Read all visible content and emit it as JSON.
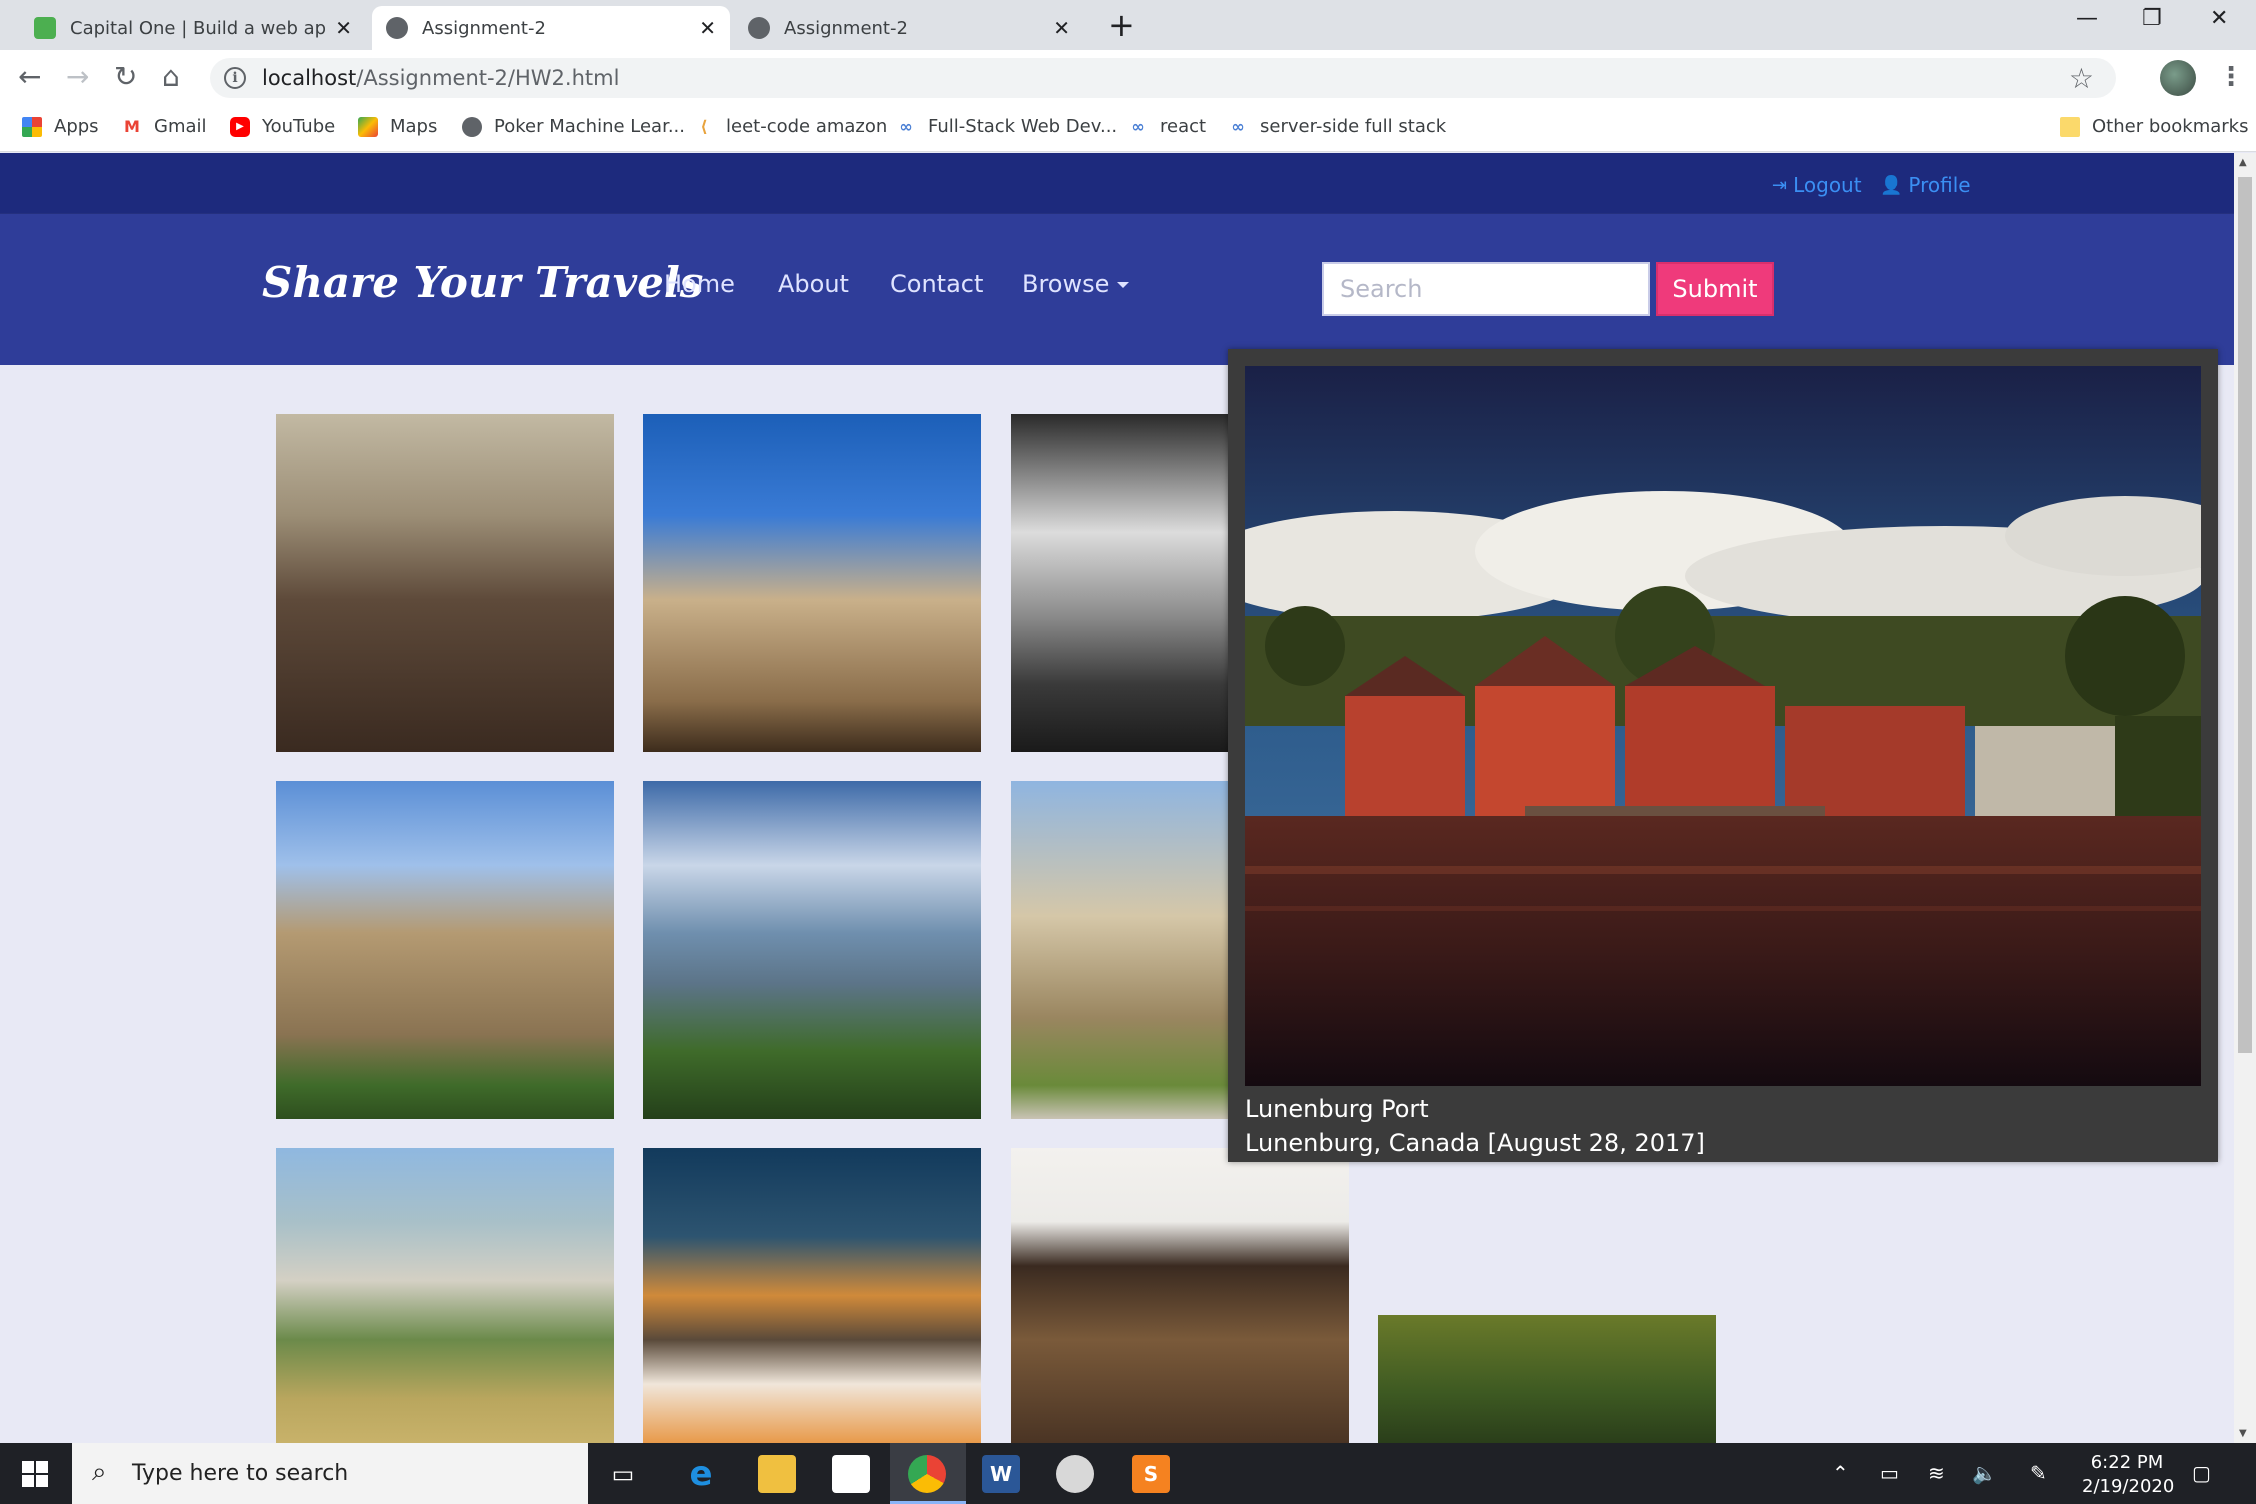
{
  "browser": {
    "tabs": [
      {
        "title": "Capital One | Build a web app to",
        "active": false,
        "favicon": "lock-icon"
      },
      {
        "title": "Assignment-2",
        "active": true,
        "favicon": "globe-icon"
      },
      {
        "title": "Assignment-2",
        "active": false,
        "favicon": "globe-icon"
      }
    ],
    "new_tab_symbol": "+",
    "close_symbol": "✕",
    "window_controls": {
      "minimize": "—",
      "restore": "❐",
      "close": "✕"
    },
    "url_host": "localhost",
    "url_path": "/Assignment-2/HW2.html",
    "nav": {
      "back": "←",
      "forward": "→",
      "reload": "↻",
      "home": "⌂"
    },
    "bookmarks": [
      {
        "label": "Apps",
        "icon": "apps-grid-icon"
      },
      {
        "label": "Gmail",
        "icon": "gmail-icon"
      },
      {
        "label": "YouTube",
        "icon": "youtube-icon"
      },
      {
        "label": "Maps",
        "icon": "maps-icon"
      },
      {
        "label": "Poker Machine Lear...",
        "icon": "globe-icon"
      },
      {
        "label": "leet-code amazon",
        "icon": "leetcode-icon"
      },
      {
        "label": "Full-Stack Web Dev...",
        "icon": "link-icon"
      },
      {
        "label": "react",
        "icon": "link-icon"
      },
      {
        "label": "server-side full stack",
        "icon": "link-icon"
      }
    ],
    "other_bookmarks": "Other bookmarks"
  },
  "site": {
    "top_links": {
      "logout": "Logout",
      "profile": "Profile"
    },
    "brand": "Share Your Travels",
    "nav": {
      "home": "Home",
      "about": "About",
      "contact": "Contact",
      "browse": "Browse"
    },
    "search_placeholder": "Search",
    "submit_label": "Submit"
  },
  "modal": {
    "title": "Lunenburg Port",
    "subtitle": "Lunenburg, Canada [August 28, 2017]"
  },
  "taskbar": {
    "search_placeholder": "Type here to search",
    "time": "6:22 PM",
    "date": "2/19/2020"
  }
}
